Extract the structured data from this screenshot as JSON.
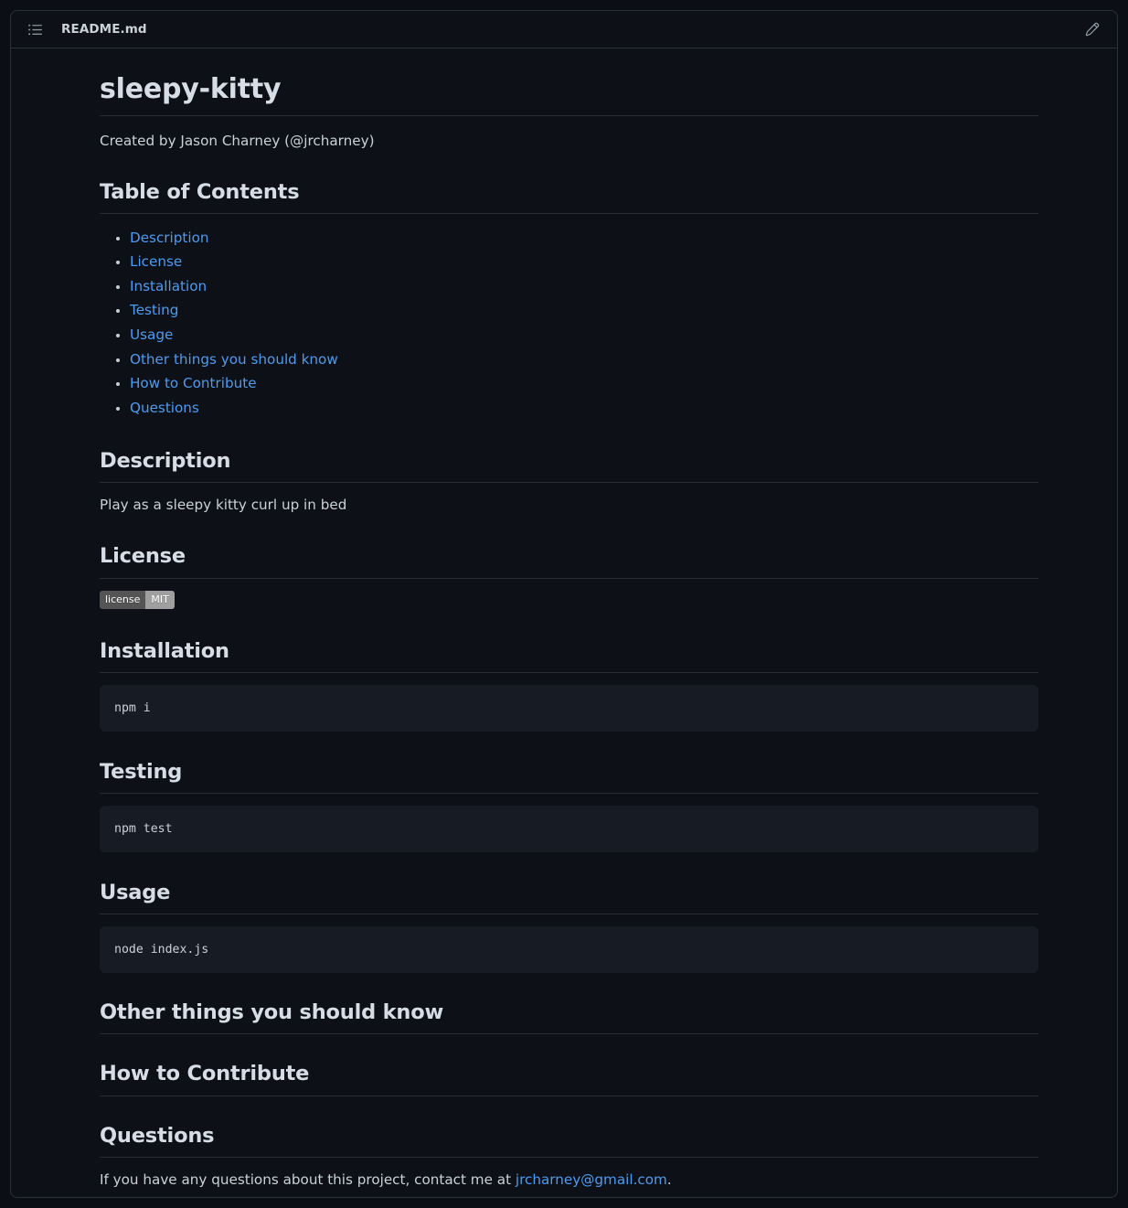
{
  "header": {
    "list_icon": "list-icon",
    "file_name": "README.md",
    "edit_icon": "pencil-icon"
  },
  "document": {
    "title": "sleepy-kitty",
    "byline": "Created by Jason Charney (@jrcharney)",
    "toc": {
      "heading": "Table of Contents",
      "items": [
        {
          "label": "Description"
        },
        {
          "label": "License"
        },
        {
          "label": "Installation"
        },
        {
          "label": "Testing"
        },
        {
          "label": "Usage"
        },
        {
          "label": "Other things you should know"
        },
        {
          "label": "How to Contribute"
        },
        {
          "label": "Questions"
        }
      ]
    },
    "sections": {
      "description": {
        "heading": "Description",
        "text": "Play as a sleepy kitty curl up in bed"
      },
      "license": {
        "heading": "License",
        "badge_left": "license",
        "badge_right": "MIT"
      },
      "installation": {
        "heading": "Installation",
        "code": "npm i"
      },
      "testing": {
        "heading": "Testing",
        "code": "npm test"
      },
      "usage": {
        "heading": "Usage",
        "code": "node index.js"
      },
      "other": {
        "heading": "Other things you should know"
      },
      "contribute": {
        "heading": "How to Contribute"
      },
      "questions": {
        "heading": "Questions",
        "text_before": "If you have any questions about this project, contact me at ",
        "email": "jrcharney@gmail.com",
        "text_after": "."
      }
    }
  },
  "colors": {
    "page_background": "#0b0e14",
    "panel_background": "#0d1117",
    "border": "#2b313b",
    "text": "#c9d1d9",
    "heading": "#d6dde6",
    "link": "#4d9bf0",
    "code_background": "#171c24",
    "badge_left": "#555555",
    "badge_right": "#9f9f9f"
  }
}
